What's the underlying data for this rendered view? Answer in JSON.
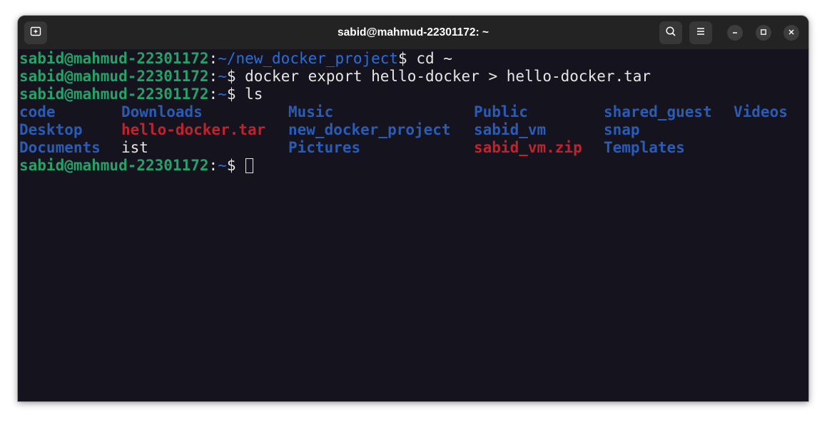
{
  "window": {
    "title": "sabid@mahmud-22301172: ~"
  },
  "titlebar": {
    "icons": [
      "new-tab-icon",
      "search-icon",
      "hamburger-menu-icon",
      "minimize-icon",
      "maximize-icon",
      "close-icon"
    ]
  },
  "terminal": {
    "user_host": "sabid@mahmud-22301172",
    "lines": [
      {
        "path": "~/new_docker_project",
        "command": " cd ~"
      },
      {
        "path": "~",
        "command": " docker export hello-docker > hello-docker.tar"
      },
      {
        "path": "~",
        "command": " ls"
      }
    ],
    "ls": {
      "row1": [
        "code",
        "Downloads",
        "Music",
        "Public",
        "shared_guest",
        "Videos"
      ],
      "row2": [
        "Desktop",
        "hello-docker.tar",
        "new_docker_project",
        "sabid_vm",
        "snap"
      ],
      "row3": [
        "Documents",
        "ist",
        "Pictures",
        "sabid_vm.zip",
        "Templates"
      ]
    },
    "prompt_path": "~",
    "colon": ":",
    "dollar": "$"
  },
  "colors": {
    "background": "#15141e",
    "titlebar": "#232323",
    "user": "#26a269",
    "path": "#2a6ed8",
    "directory": "#2a5bb5",
    "archive": "#c0232e",
    "text": "#e6e6e6"
  }
}
